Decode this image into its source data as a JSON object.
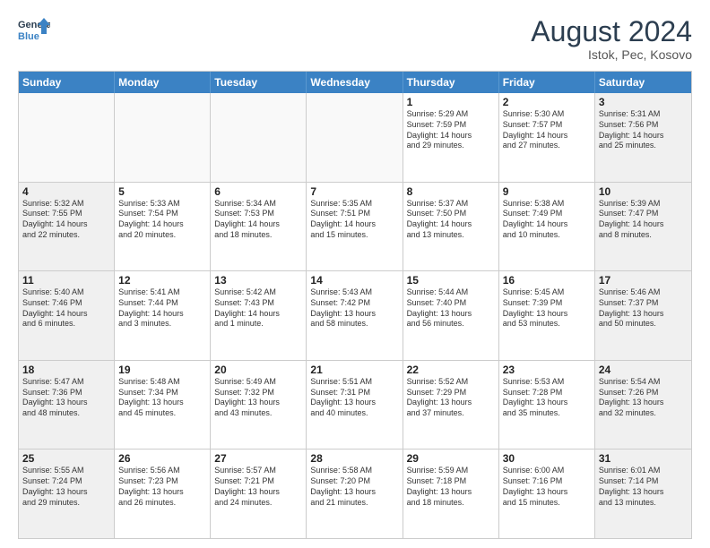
{
  "logo": {
    "line1": "General",
    "line2": "Blue"
  },
  "title": "August 2024",
  "location": "Istok, Pec, Kosovo",
  "days_header": [
    "Sunday",
    "Monday",
    "Tuesday",
    "Wednesday",
    "Thursday",
    "Friday",
    "Saturday"
  ],
  "rows": [
    [
      {
        "day": "",
        "info": ""
      },
      {
        "day": "",
        "info": ""
      },
      {
        "day": "",
        "info": ""
      },
      {
        "day": "",
        "info": ""
      },
      {
        "day": "1",
        "info": "Sunrise: 5:29 AM\nSunset: 7:59 PM\nDaylight: 14 hours\nand 29 minutes."
      },
      {
        "day": "2",
        "info": "Sunrise: 5:30 AM\nSunset: 7:57 PM\nDaylight: 14 hours\nand 27 minutes."
      },
      {
        "day": "3",
        "info": "Sunrise: 5:31 AM\nSunset: 7:56 PM\nDaylight: 14 hours\nand 25 minutes."
      }
    ],
    [
      {
        "day": "4",
        "info": "Sunrise: 5:32 AM\nSunset: 7:55 PM\nDaylight: 14 hours\nand 22 minutes."
      },
      {
        "day": "5",
        "info": "Sunrise: 5:33 AM\nSunset: 7:54 PM\nDaylight: 14 hours\nand 20 minutes."
      },
      {
        "day": "6",
        "info": "Sunrise: 5:34 AM\nSunset: 7:53 PM\nDaylight: 14 hours\nand 18 minutes."
      },
      {
        "day": "7",
        "info": "Sunrise: 5:35 AM\nSunset: 7:51 PM\nDaylight: 14 hours\nand 15 minutes."
      },
      {
        "day": "8",
        "info": "Sunrise: 5:37 AM\nSunset: 7:50 PM\nDaylight: 14 hours\nand 13 minutes."
      },
      {
        "day": "9",
        "info": "Sunrise: 5:38 AM\nSunset: 7:49 PM\nDaylight: 14 hours\nand 10 minutes."
      },
      {
        "day": "10",
        "info": "Sunrise: 5:39 AM\nSunset: 7:47 PM\nDaylight: 14 hours\nand 8 minutes."
      }
    ],
    [
      {
        "day": "11",
        "info": "Sunrise: 5:40 AM\nSunset: 7:46 PM\nDaylight: 14 hours\nand 6 minutes."
      },
      {
        "day": "12",
        "info": "Sunrise: 5:41 AM\nSunset: 7:44 PM\nDaylight: 14 hours\nand 3 minutes."
      },
      {
        "day": "13",
        "info": "Sunrise: 5:42 AM\nSunset: 7:43 PM\nDaylight: 14 hours\nand 1 minute."
      },
      {
        "day": "14",
        "info": "Sunrise: 5:43 AM\nSunset: 7:42 PM\nDaylight: 13 hours\nand 58 minutes."
      },
      {
        "day": "15",
        "info": "Sunrise: 5:44 AM\nSunset: 7:40 PM\nDaylight: 13 hours\nand 56 minutes."
      },
      {
        "day": "16",
        "info": "Sunrise: 5:45 AM\nSunset: 7:39 PM\nDaylight: 13 hours\nand 53 minutes."
      },
      {
        "day": "17",
        "info": "Sunrise: 5:46 AM\nSunset: 7:37 PM\nDaylight: 13 hours\nand 50 minutes."
      }
    ],
    [
      {
        "day": "18",
        "info": "Sunrise: 5:47 AM\nSunset: 7:36 PM\nDaylight: 13 hours\nand 48 minutes."
      },
      {
        "day": "19",
        "info": "Sunrise: 5:48 AM\nSunset: 7:34 PM\nDaylight: 13 hours\nand 45 minutes."
      },
      {
        "day": "20",
        "info": "Sunrise: 5:49 AM\nSunset: 7:32 PM\nDaylight: 13 hours\nand 43 minutes."
      },
      {
        "day": "21",
        "info": "Sunrise: 5:51 AM\nSunset: 7:31 PM\nDaylight: 13 hours\nand 40 minutes."
      },
      {
        "day": "22",
        "info": "Sunrise: 5:52 AM\nSunset: 7:29 PM\nDaylight: 13 hours\nand 37 minutes."
      },
      {
        "day": "23",
        "info": "Sunrise: 5:53 AM\nSunset: 7:28 PM\nDaylight: 13 hours\nand 35 minutes."
      },
      {
        "day": "24",
        "info": "Sunrise: 5:54 AM\nSunset: 7:26 PM\nDaylight: 13 hours\nand 32 minutes."
      }
    ],
    [
      {
        "day": "25",
        "info": "Sunrise: 5:55 AM\nSunset: 7:24 PM\nDaylight: 13 hours\nand 29 minutes."
      },
      {
        "day": "26",
        "info": "Sunrise: 5:56 AM\nSunset: 7:23 PM\nDaylight: 13 hours\nand 26 minutes."
      },
      {
        "day": "27",
        "info": "Sunrise: 5:57 AM\nSunset: 7:21 PM\nDaylight: 13 hours\nand 24 minutes."
      },
      {
        "day": "28",
        "info": "Sunrise: 5:58 AM\nSunset: 7:20 PM\nDaylight: 13 hours\nand 21 minutes."
      },
      {
        "day": "29",
        "info": "Sunrise: 5:59 AM\nSunset: 7:18 PM\nDaylight: 13 hours\nand 18 minutes."
      },
      {
        "day": "30",
        "info": "Sunrise: 6:00 AM\nSunset: 7:16 PM\nDaylight: 13 hours\nand 15 minutes."
      },
      {
        "day": "31",
        "info": "Sunrise: 6:01 AM\nSunset: 7:14 PM\nDaylight: 13 hours\nand 13 minutes."
      }
    ]
  ]
}
